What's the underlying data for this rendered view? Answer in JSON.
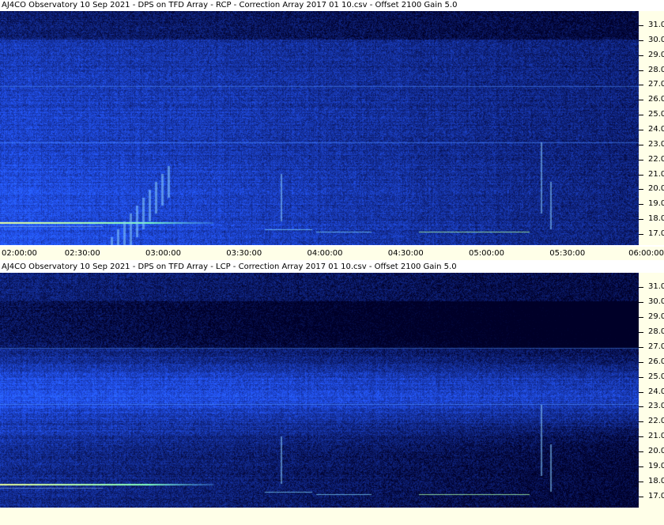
{
  "panels": [
    {
      "caption": "AJ4CO Observatory 10 Sep 2021  -  DPS on TFD Array  -  RCP  -  Correction Array 2017 01 10.csv  -  Offset 2100  Gain 5.0",
      "y_labels": [
        "31.0",
        "30.0",
        "29.0",
        "28.0",
        "27.0",
        "26.0",
        "25.0",
        "24.0",
        "23.0",
        "22.0",
        "21.0",
        "20.0",
        "19.0",
        "18.0",
        "17.0"
      ]
    },
    {
      "caption": "AJ4CO Observatory 10 Sep 2021  -  DPS on TFD Array  -  LCP  -  Correction Array 2017 01 10.csv  -  Offset 2100  Gain 5.0",
      "y_labels": [
        "31.0",
        "30.0",
        "29.0",
        "28.0",
        "27.0",
        "26.0",
        "25.0",
        "24.0",
        "23.0",
        "22.0",
        "21.0",
        "20.0",
        "19.0",
        "18.0",
        "17.0"
      ]
    }
  ],
  "time_axis": {
    "labels": [
      "02:00:00",
      "02:30:00",
      "03:00:00",
      "03:30:00",
      "04:00:00",
      "04:30:00",
      "05:00:00",
      "05:30:00",
      "06:00:00"
    ]
  },
  "colors": {
    "background_deep": "#00082a",
    "background_blue": "#1a4ad8",
    "band_light": "#3f8cff",
    "emission_green": "#b8ffb0",
    "axis_bg": "#ffffe8"
  }
}
